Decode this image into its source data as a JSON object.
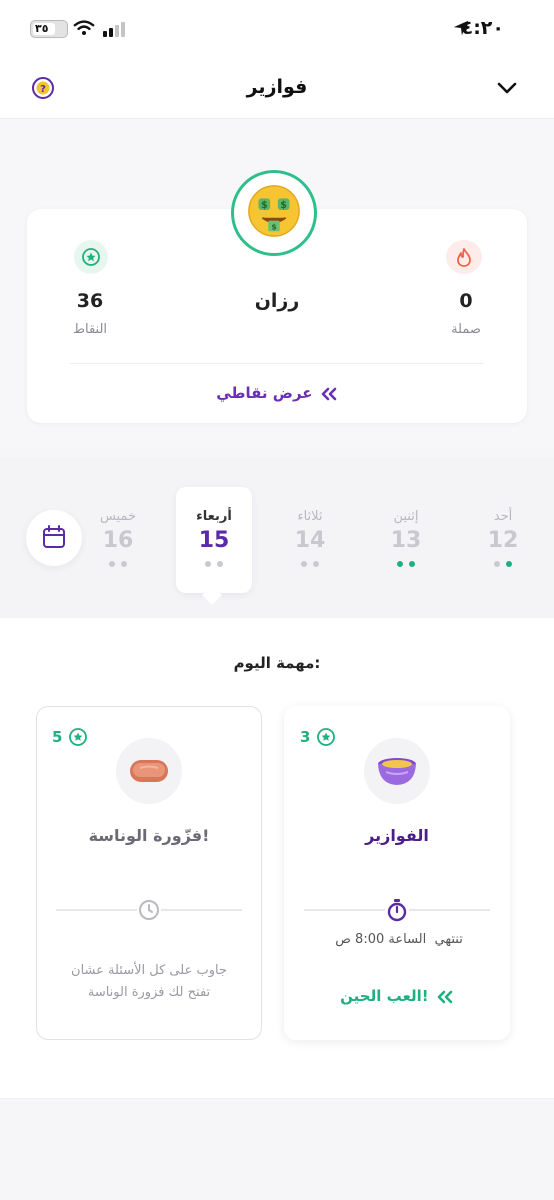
{
  "status_bar": {
    "time": "٤:٢٠",
    "battery_text": "٣٥"
  },
  "header": {
    "title": "فوازير"
  },
  "profile": {
    "name": "رزان",
    "points_value": "36",
    "points_label": "النقاط",
    "streak_value": "0",
    "streak_label": "صملة",
    "view_points_link": "عرض نقاطي"
  },
  "week": [
    {
      "name": "أحد",
      "date": "12",
      "dots": [
        "gray",
        "green"
      ]
    },
    {
      "name": "إثنين",
      "date": "13",
      "dots": [
        "green",
        "green"
      ]
    },
    {
      "name": "ثلاثاء",
      "date": "14",
      "dots": [
        "gray",
        "gray"
      ]
    },
    {
      "name": "أربعاء",
      "date": "15",
      "dots": [
        "gray",
        "gray"
      ],
      "active": true
    },
    {
      "name": "خميس",
      "date": "16",
      "dots": [
        "gray",
        "gray"
      ]
    }
  ],
  "today_task": {
    "title": "مهمة اليوم:"
  },
  "tasks": [
    {
      "points": "3",
      "title": "الفوازير",
      "ends_label": "تنتهي",
      "ends_time": "الساعة 8:00 ص",
      "play_link": "العب الحين!"
    },
    {
      "points": "5",
      "title": "فزّورة الوناسة!",
      "description_line1": "جاوب على كل الأسئلة عشان",
      "description_line2": "تفتح لك فزورة الوناسة"
    }
  ],
  "colors": {
    "brand_purple": "#5a2aa8",
    "accent_green": "#1fb07f",
    "avatar_ring": "#2fbf8b"
  },
  "icons": [
    "location-arrow-icon",
    "wifi-icon",
    "signal-icon",
    "battery-icon",
    "help-icon",
    "chevron-down-icon",
    "star-icon",
    "fire-icon",
    "money-face-icon",
    "calendar-icon",
    "bowl-icon",
    "bread-icon",
    "stopwatch-icon",
    "clock-icon",
    "double-chevron-left-icon"
  ]
}
